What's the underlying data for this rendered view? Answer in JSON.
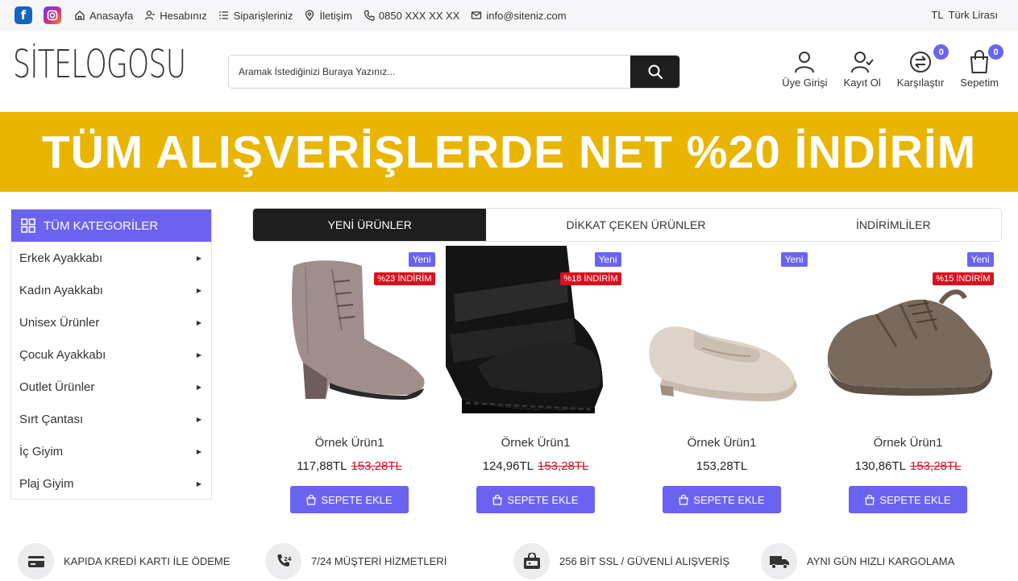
{
  "topbar": {
    "social": [
      {
        "name": "facebook-icon",
        "glyph": "f"
      },
      {
        "name": "instagram-icon",
        "glyph": "◎"
      }
    ],
    "links": [
      {
        "icon": "home-icon",
        "label": "Anasayfa"
      },
      {
        "icon": "user-icon",
        "label": "Hesabınız"
      },
      {
        "icon": "list-icon",
        "label": "Siparişleriniz"
      },
      {
        "icon": "location-icon",
        "label": "İletişim"
      },
      {
        "icon": "phone-icon",
        "label": "0850 XXX XX XX"
      },
      {
        "icon": "mail-icon",
        "label": "info@siteniz.com"
      }
    ],
    "currency_code": "TL",
    "currency_label": "Türk Lirası"
  },
  "header": {
    "logo": "SİTELOGOSU",
    "search_placeholder": "Aramak İstediğinizi Buraya Yazınız...",
    "icons": [
      {
        "icon": "user-icon",
        "label": "Üye Girişi"
      },
      {
        "icon": "user-check-icon",
        "label": "Kayıt Ol"
      },
      {
        "icon": "compare-icon",
        "label": "Karşılaştır",
        "badge": "0"
      },
      {
        "icon": "bag-icon",
        "label": "Sepetim",
        "badge": "0"
      }
    ]
  },
  "banner": {
    "text": "TÜM ALIŞVERİŞLERDE NET %20 İNDİRİM",
    "bg_color": "#e9b500"
  },
  "sidebar": {
    "title": "TÜM KATEGORİLER",
    "items": [
      "Erkek Ayakkabı",
      "Kadın Ayakkabı",
      "Unisex Ürünler",
      "Çocuk Ayakkabı",
      "Outlet Ürünler",
      "Sırt Çantası",
      "İç Giyim",
      "Plaj Giyim"
    ]
  },
  "tabs": [
    "YENİ ÜRÜNLER",
    "DİKKAT ÇEKEN ÜRÜNLER",
    "İNDİRİMLİLER"
  ],
  "products": [
    {
      "name": "Örnek Ürün1",
      "price": "117,88TL",
      "old_price": "153,28TL",
      "tag": "Yeni",
      "discount": "%23 İNDİRİM",
      "image": "ankle-boot-image"
    },
    {
      "name": "Örnek Ürün1",
      "price": "124,96TL",
      "old_price": "153,28TL",
      "tag": "Yeni",
      "discount": "%18 İNDİRİM",
      "image": "black-boot-image"
    },
    {
      "name": "Örnek Ürün1",
      "price": "153,28TL",
      "old_price": "",
      "tag": "Yeni",
      "discount": "",
      "image": "loafer-image"
    },
    {
      "name": "Örnek Ürün1",
      "price": "130,86TL",
      "old_price": "153,28TL",
      "tag": "Yeni",
      "discount": "%15 İNDİRİM",
      "image": "sneaker-image"
    }
  ],
  "add_to_cart": "SEPETE EKLE",
  "features": [
    {
      "icon": "card-icon",
      "label": "KAPIDA KREDİ KARTI İLE ÖDEME"
    },
    {
      "icon": "support-24-icon",
      "label": "7/24 MÜŞTERİ HİZMETLERİ"
    },
    {
      "icon": "ssl-icon",
      "label": "256 BİT SSL / GÜVENLİ ALIŞVERİŞ"
    },
    {
      "icon": "truck-icon",
      "label": "AYNI GÜN HIZLI KARGOLAMA"
    }
  ],
  "colors": {
    "accent": "#6a63f2",
    "discount": "#d9101e",
    "dark": "#1e1e1e"
  }
}
